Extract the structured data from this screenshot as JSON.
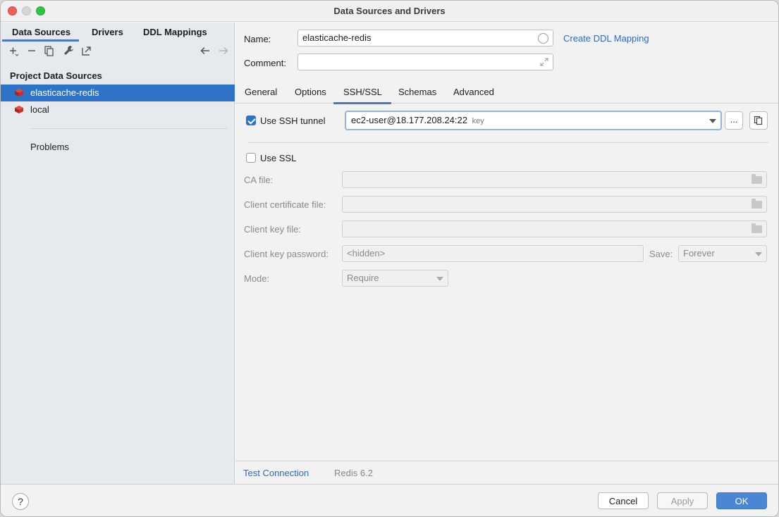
{
  "window": {
    "title": "Data Sources and Drivers"
  },
  "left": {
    "tabs": [
      {
        "label": "Data Sources",
        "active": true
      },
      {
        "label": "Drivers",
        "active": false
      },
      {
        "label": "DDL Mappings",
        "active": false
      }
    ],
    "toolbar": [
      "add-icon",
      "remove-icon",
      "duplicate-icon",
      "wrench-icon",
      "open-external-icon",
      "back-arrow-icon",
      "forward-arrow-icon"
    ],
    "section_title": "Project Data Sources",
    "items": [
      {
        "label": "elasticache-redis",
        "selected": true
      },
      {
        "label": "local",
        "selected": false
      }
    ],
    "problems_label": "Problems"
  },
  "form": {
    "name_label": "Name:",
    "name_value": "elasticache-redis",
    "create_ddl_link": "Create DDL Mapping",
    "comment_label": "Comment:",
    "comment_value": ""
  },
  "tabs": [
    {
      "label": "General",
      "active": false
    },
    {
      "label": "Options",
      "active": false
    },
    {
      "label": "SSH/SSL",
      "active": true
    },
    {
      "label": "Schemas",
      "active": false
    },
    {
      "label": "Advanced",
      "active": false
    }
  ],
  "ssh": {
    "checkbox_label": "Use SSH tunnel",
    "checked": true,
    "tunnel_value": "ec2-user@18.177.208.24:22",
    "tunnel_hint": "key",
    "more_button": "..."
  },
  "ssl": {
    "checkbox_label": "Use SSL",
    "checked": false,
    "ca_file_label": "CA file:",
    "client_cert_label": "Client certificate file:",
    "client_key_label": "Client key file:",
    "client_key_password_label": "Client key password:",
    "client_key_password_value": "<hidden>",
    "save_label": "Save:",
    "save_value": "Forever",
    "mode_label": "Mode:",
    "mode_value": "Require"
  },
  "status": {
    "test_connection": "Test Connection",
    "driver_version": "Redis 6.2"
  },
  "buttons": {
    "help": "?",
    "cancel": "Cancel",
    "apply": "Apply",
    "ok": "OK"
  },
  "colors": {
    "accent": "#2f73c9",
    "link": "#2b6ac9",
    "redis": "#c8302b"
  }
}
